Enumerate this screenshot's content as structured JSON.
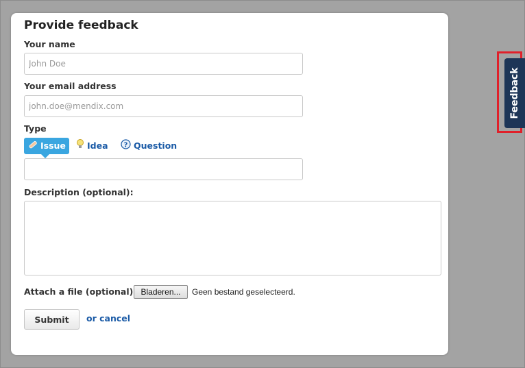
{
  "form": {
    "title": "Provide feedback",
    "name_label": "Your name",
    "name_placeholder": "John Doe",
    "email_label": "Your email address",
    "email_placeholder": "john.doe@mendix.com",
    "type_label": "Type",
    "type_options": [
      {
        "label": "Issue",
        "icon": "bandage-icon",
        "selected": true
      },
      {
        "label": "Idea",
        "icon": "lightbulb-icon",
        "selected": false
      },
      {
        "label": "Question",
        "icon": "question-icon",
        "selected": false
      }
    ],
    "summary_value": "",
    "description_label": "Description (optional):",
    "description_value": "",
    "attach_label": "Attach a file (optional):",
    "browse_label": "Bladeren...",
    "file_status": "Geen bestand geselecteerd.",
    "submit_label": "Submit",
    "cancel_label": "or cancel"
  },
  "feedback_tab": {
    "label": "Feedback"
  },
  "colors": {
    "background": "#a3a3a3",
    "selected_type": "#3aa6e0",
    "link": "#1a5aa6",
    "feedback_tab": "#1d3557",
    "highlight": "#e0202a"
  }
}
